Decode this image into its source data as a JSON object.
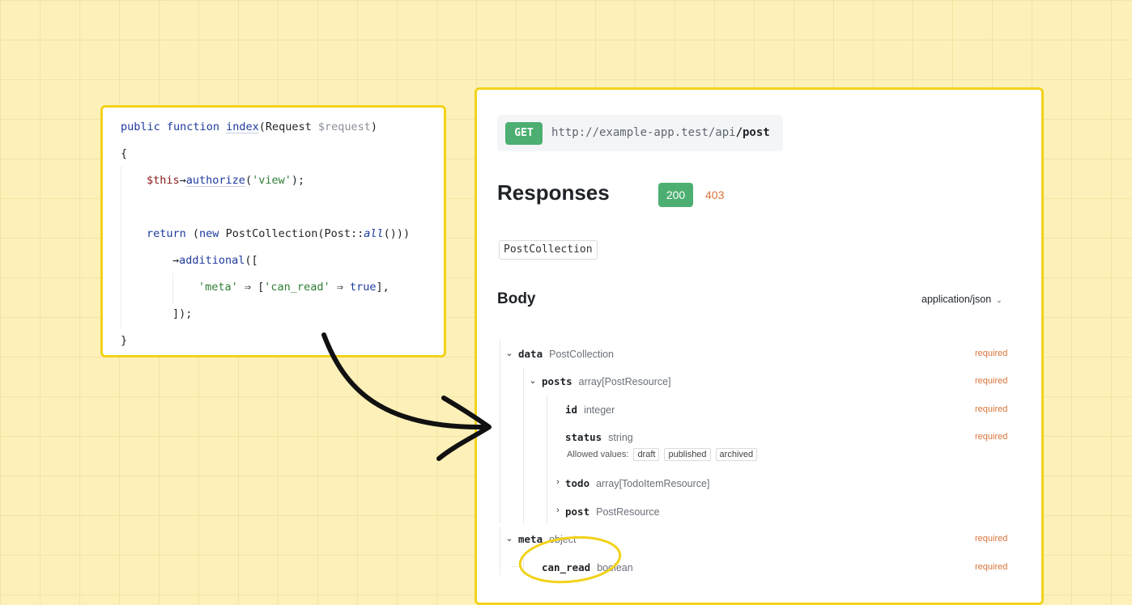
{
  "code": {
    "line1": {
      "kw1": "public",
      "kw2": "function",
      "name": "index",
      "open": "(Request ",
      "param": "$request",
      "close": ")"
    },
    "line2": "{",
    "line3": {
      "this": "$this",
      "arrow": "→",
      "method": "authorize",
      "open": "(",
      "str": "'view'",
      "close": ");"
    },
    "line5": {
      "kw": "return",
      "open": " (",
      "kw2": "new",
      "cls": " PostCollection(Post::",
      "fn": "all",
      "close": "()))"
    },
    "line6": {
      "arrow": "→",
      "method": "additional",
      "open": "(["
    },
    "line7": {
      "key": "'meta'",
      "arrow": " ⇒ [",
      "key2": "'can_read'",
      "arrow2": " ⇒ ",
      "val": "true",
      "close": "],"
    },
    "line8": "]);",
    "line9": "}"
  },
  "api": {
    "method": "GET",
    "url_base": "http://example-app.test/api",
    "url_path": "/post",
    "responses_title": "Responses",
    "codes": [
      "200",
      "403"
    ],
    "schema_name": "PostCollection",
    "body_title": "Body",
    "content_type": "application/json",
    "fields": {
      "data": {
        "name": "data",
        "type": "PostCollection",
        "required": "required"
      },
      "posts": {
        "name": "posts",
        "type": "array[PostResource]",
        "required": "required"
      },
      "id": {
        "name": "id",
        "type": "integer",
        "required": "required"
      },
      "status": {
        "name": "status",
        "type": "string",
        "required": "required",
        "allowed_label": "Allowed values:",
        "allowed": [
          "draft",
          "published",
          "archived"
        ]
      },
      "todo": {
        "name": "todo",
        "type": "array[TodoItemResource]"
      },
      "post": {
        "name": "post",
        "type": "PostResource"
      },
      "meta": {
        "name": "meta",
        "type": "object",
        "required": "required"
      },
      "can_read": {
        "name": "can_read",
        "type": "boolean",
        "required": "required"
      }
    }
  },
  "colors": {
    "background": "#fdf1b9",
    "highlight": "#f2d21b",
    "success": "#4caf71",
    "required": "#d8743a"
  }
}
